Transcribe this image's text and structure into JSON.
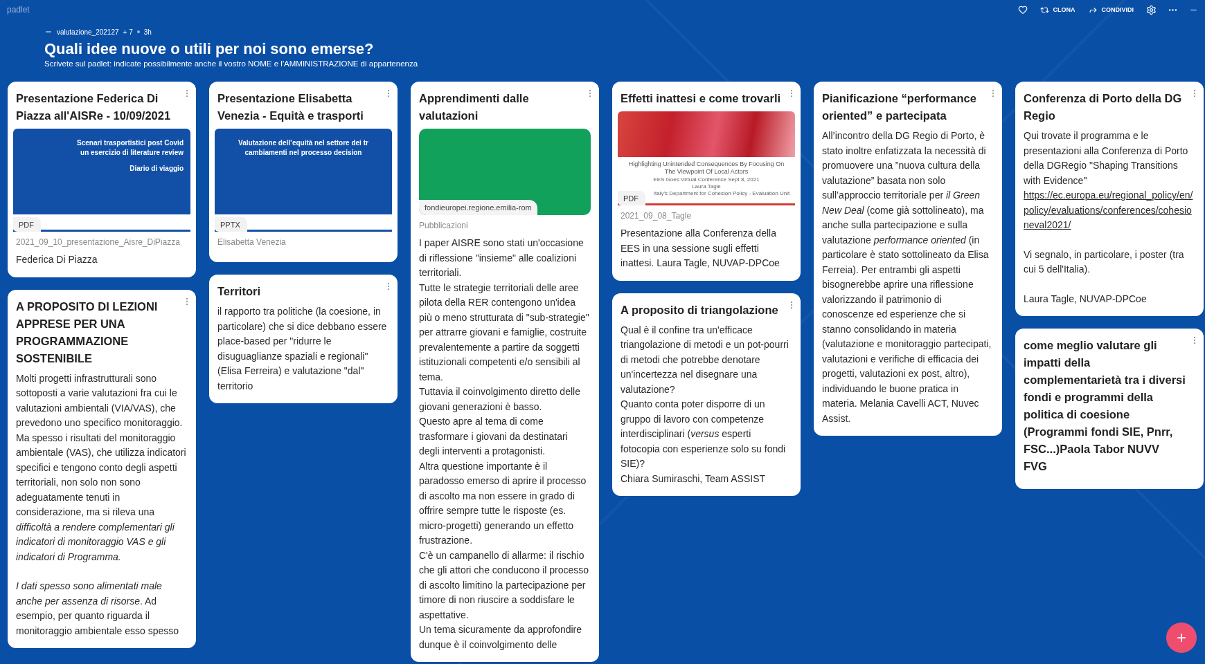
{
  "app": {
    "logo": "padlet",
    "actions": [
      {
        "kind": "like"
      },
      {
        "kind": "clone",
        "label": "CLONA"
      },
      {
        "kind": "share",
        "label": "CONDIVIDI"
      },
      {
        "kind": "settings"
      },
      {
        "kind": "more"
      },
      {
        "kind": "minimize"
      }
    ]
  },
  "board": {
    "meta": {
      "author": "valutazione_202127",
      "contributors": "+ 7",
      "time": "3h"
    },
    "title": "Quali idee nuove o utili per noi sono emerse?",
    "subtitle": "Scrivete sul padlet: indicate possibilmente anche il vostro NOME e l'AMMINISTRAZIONE di appartenenza"
  },
  "columns": [
    [
      {
        "title": "Presentazione Federica Di Piazza all'AISRe - 10/09/2021",
        "attachment": {
          "kind": "cover",
          "badge": "PDF",
          "heading_lines": [
            "Scenari trasportistici post Covid",
            "un esercizio di literature review"
          ],
          "subheading": "Diario di viaggio"
        },
        "caption": "2021_09_10_presentazione_Aisre_DiPiazza",
        "paragraphs": [
          {
            "text": "Federica Di Piazza"
          }
        ]
      },
      {
        "title": "A PROPOSITO DI LEZIONI APPRESE PER UNA PROGRAMMAZIONE SOSTENIBILE",
        "paragraphs": [
          {
            "text": "Molti progetti infrastrutturali sono sottoposti a varie valutazioni fra cui le valutazioni ambientali (VIA/VAS), che prevedono uno specifico monitoraggio. Ma spesso i risultati del monitoraggio ambientale (VAS), che utilizza indicatori specifici e tengono conto degli aspetti territoriali, non solo non sono adeguatamente tenuti in considerazione, ma si rileva una *difficoltà a rendere complementari gli indicatori di monitoraggio VAS e gli indicatori di Programma.*"
          },
          {
            "text": "*I dati spesso sono alimentati male anche per assenza di risorse*. Ad esempio, per quanto riguarda il monitoraggio ambientale esso spesso"
          }
        ]
      }
    ],
    [
      {
        "title": "Presentazione Elisabetta Venezia - Equità e trasporti",
        "attachment": {
          "kind": "slide",
          "badge": "PPTX",
          "heading_lines": [
            "Valutazione dell’equità nel settore dei tr",
            "cambiamenti nel processo decision"
          ]
        },
        "caption": "Elisabetta Venezia"
      },
      {
        "title": "Territori",
        "paragraphs": [
          {
            "text": "il rapporto tra politiche (la coesione, in particolare) che si dice debbano essere place-based per \"ridurre le disuguaglianze spaziali e regionali\" (Elisa Ferreira) e valutazione \"dal\" territorio"
          }
        ]
      }
    ],
    [
      {
        "title": "Apprendimenti dalle valutazioni",
        "attachment": {
          "kind": "link",
          "url": "fondieuropei.regione.emilia-rom"
        },
        "caption": "Pubblicazioni",
        "paragraphs": [
          {
            "text": "I paper AISRE sono stati un'occasione di riflessione \"insieme\" alle coalizioni territoriali.\nTutte le strategie territoriali delle aree pilota della RER contengono un'idea più o meno strutturata di \"sub-strategie\" per attrarre giovani e famiglie, costruite prevalentemente a partire da soggetti istituzionali competenti e/o sensibili al tema.\nTuttavia il coinvolgimento diretto delle giovani generazioni è basso.\nQuesto apre al tema di come trasformare i giovani da destinatari degli interventi a protagonisti.\nAltra questione importante è il paradosso emerso di aprire il processo di ascolto ma non essere in grado di offrire sempre tutte le risposte (es. micro-progetti) generando un effetto frustrazione.\nC'è un campanello di allarme: il rischio che gli attori che conducono il processo di ascolto limitino la partecipazione per timore di non riuscire a soddisfare le aspettative.\nUn tema sicuramente da approfondire dunque è il coinvolgimento delle"
          }
        ]
      }
    ],
    [
      {
        "title": "Effetti inattesi e come trovarli",
        "attachment": {
          "kind": "document",
          "badge": "PDF",
          "doc_title": "Highlighting Unintended Consequences By Focusing On The Viewpoint Of Local Actors",
          "event": "EES Goes Virtual Conference Sept 8, 2021",
          "author": "Laura Tagle",
          "affiliation": "Italy's Department for Cohesion Policy - Evaluation Unit"
        },
        "caption": "2021_09_08_Tagle",
        "paragraphs": [
          {
            "text": "Presentazione alla Conferenza della EES in una sessione sugli effetti inattesi. Laura Tagle, NUVAP-DPCoe"
          }
        ]
      },
      {
        "title": "A proposito di triangolazione",
        "paragraphs": [
          {
            "text": "Qual è il confine tra un'efficace triangolazione di metodi e un pot-pourri di metodi che potrebbe denotare un'incertezza nel disegnare una valutazione?\nQuanto conta poter disporre di un gruppo di lavoro con competenze interdisciplinari (*versus* esperti fotocopia con esperienze solo su fondi SIE)?\nChiara Sumiraschi, Team ASSIST"
          }
        ]
      }
    ],
    [
      {
        "title": "Pianificazione “performance oriented” e partecipata",
        "paragraphs": [
          {
            "text": "All’incontro della DG Regio di Porto, è stato inoltre enfatizzata la necessità di promuovere una ”nuova cultura della valutazione” basata non solo sull’approccio territoriale per *il Green New Deal* (come già sottolineato), ma anche sulla partecipazione e sulla valutazione *performance oriented* (in particolare è stato sottolineato da Elisa Ferreia). Per entrambi gli aspetti bisognerebbe aprire una riflessione valorizzando il patrimonio di conoscenze ed esperienze che si stanno consolidando in materia (valutazione e monitoraggio partecipati, valutazioni e verifiche di efficacia dei progetti, valutazioni ex post, altro), individuando le buone pratica in materia. Melania Cavelli ACT, Nuvec Assist."
          }
        ]
      }
    ],
    [
      {
        "title": "Conferenza di Porto della DG Regio",
        "paragraphs": [
          {
            "text": "Qui trovate il programma e le presentazioni alla Conferenza di Porto della DGRegio \"Shaping Transitions with Evidence\"",
            "link": "https://ec.europa.eu/regional_policy/en/policy/evaluations/conferences/cohesioneval2021/"
          },
          {
            "text": "Vi segnalo, in particolare, i poster (tra cui 5 dell'Italia)."
          },
          {
            "text": "Laura Tagle, NUVAP-DPCoe"
          }
        ]
      },
      {
        "title": "come meglio valutare gli impatti della complementarietà tra i diversi fondi e programmi della politica di coesione (Programmi fondi SIE, Pnrr, FSC...)Paola Tabor NUVV FVG"
      }
    ]
  ],
  "add_button": "+"
}
